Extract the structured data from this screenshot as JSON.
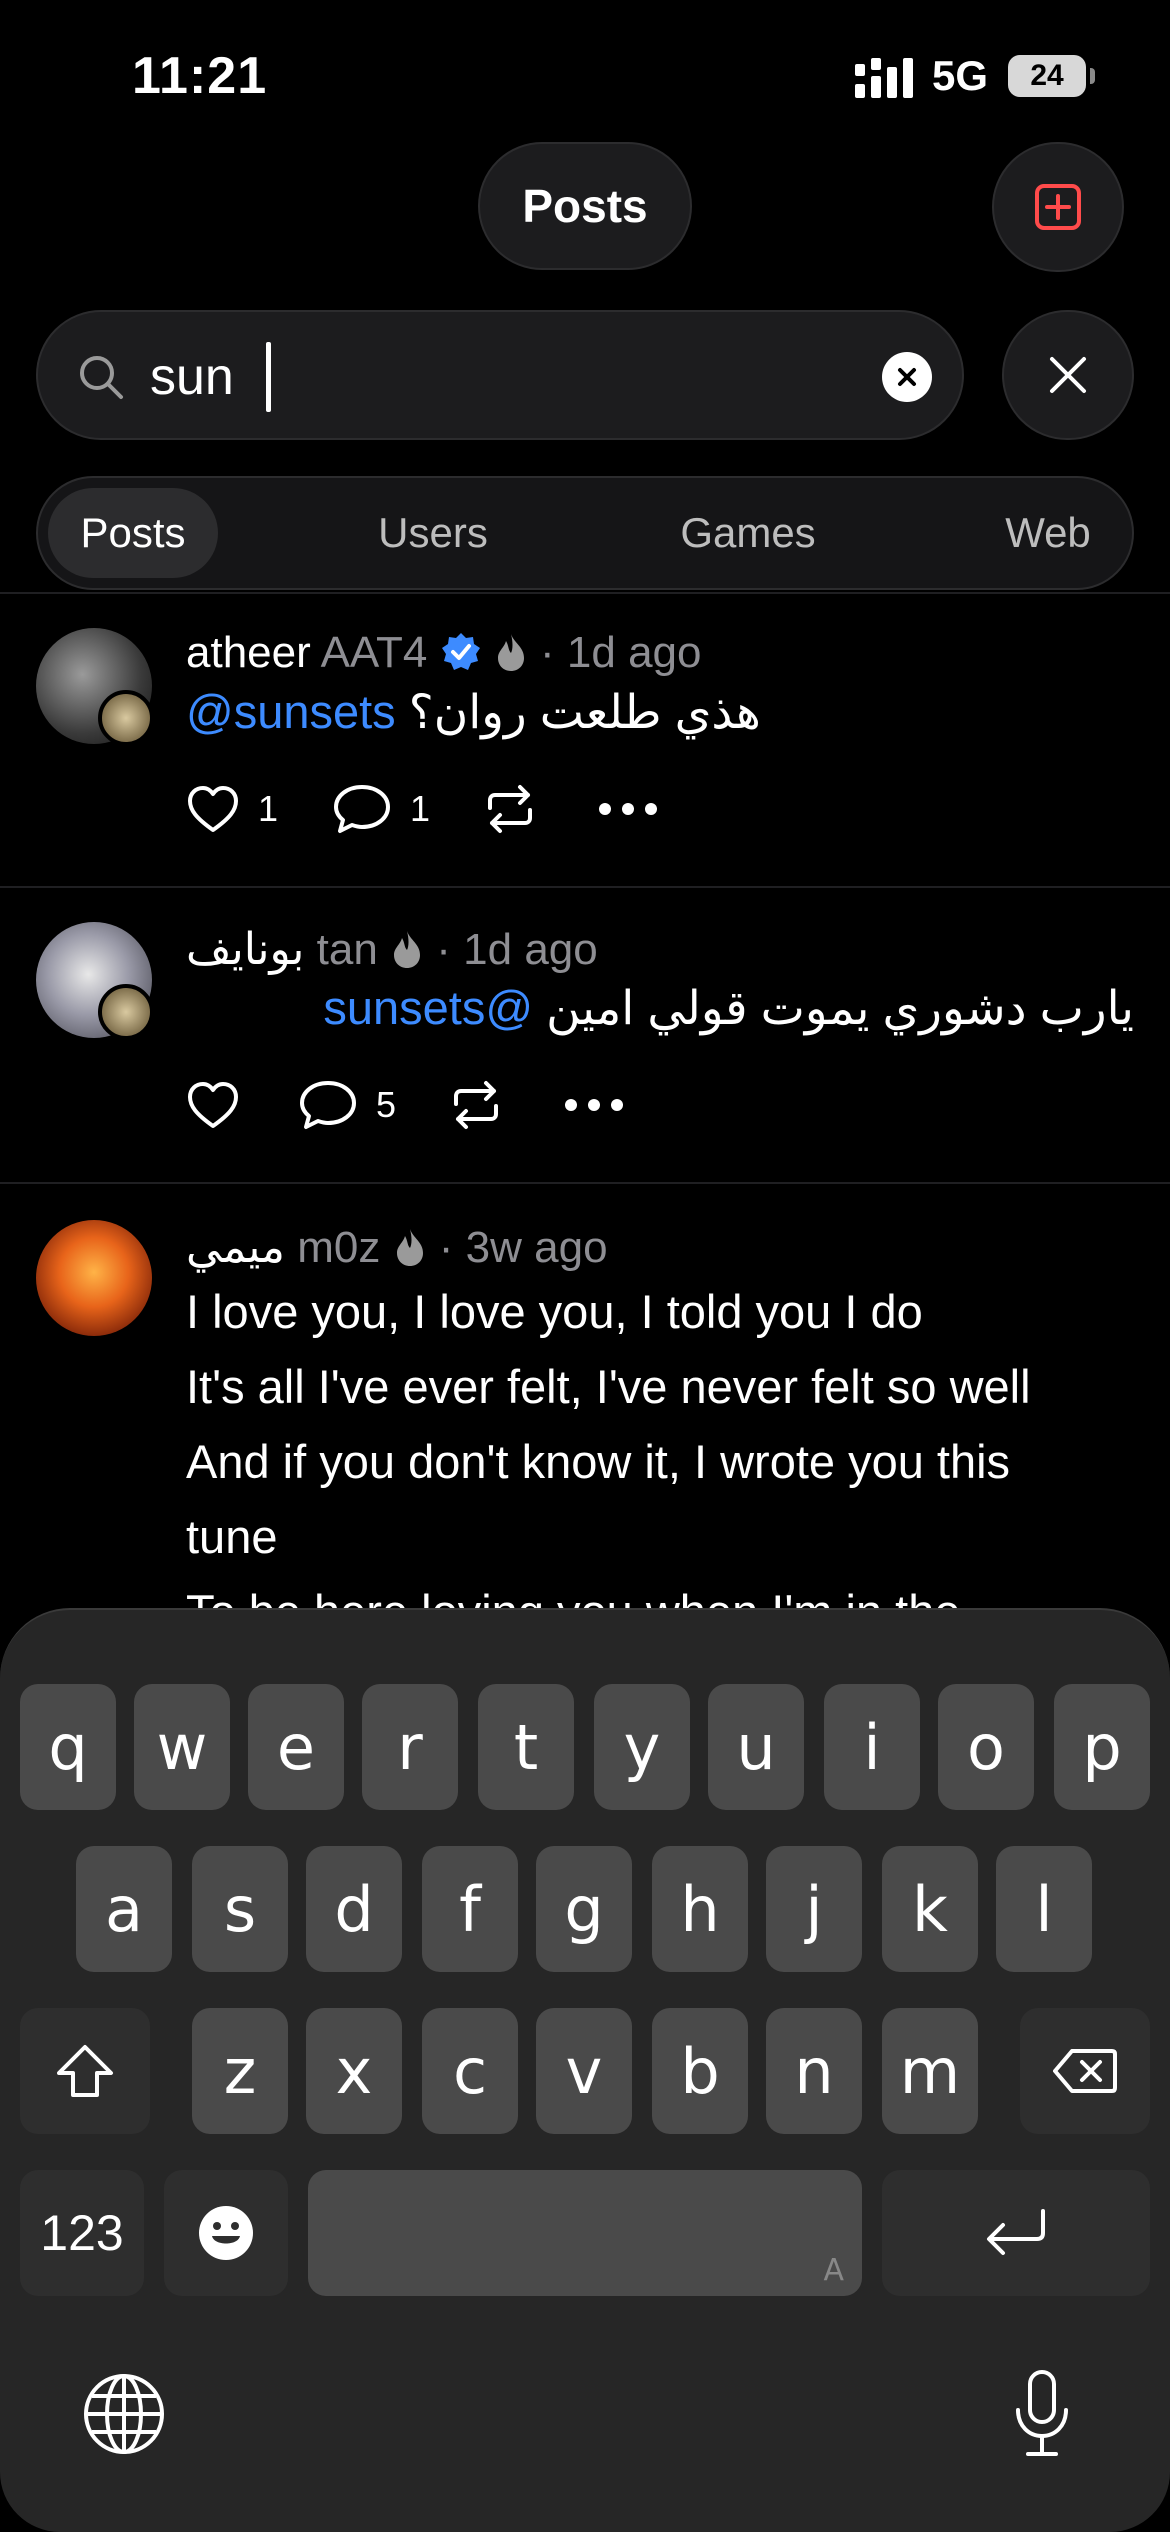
{
  "status_bar": {
    "time": "11:21",
    "network": "5G",
    "battery": "24"
  },
  "header": {
    "title": "Posts",
    "new_post_icon": "plus-square-icon"
  },
  "search": {
    "value": "sun",
    "placeholder": "Search"
  },
  "tabs": [
    {
      "label": "Posts",
      "active": true
    },
    {
      "label": "Users",
      "active": false
    },
    {
      "label": "Games",
      "active": false
    },
    {
      "label": "Web",
      "active": false
    }
  ],
  "posts": [
    {
      "name": "atheer",
      "handle": "AAT4",
      "verified": true,
      "time": "· 1d ago",
      "mention": "@sunsets",
      "text": "هذي طلعت روان؟",
      "likes": "1",
      "comments": "1"
    },
    {
      "name": "بونايف",
      "handle": "tan",
      "verified": false,
      "time": "· 1d ago",
      "mention": "sunsets@",
      "text": "يارب دشوري يموت قولي امين",
      "likes": "",
      "comments": "5"
    },
    {
      "name": "ميمي",
      "handle": "m0z",
      "verified": false,
      "time": "· 3w ago",
      "lines": [
        "I love you, I love you, I told you I do",
        "It's all I've ever felt, I've never felt so well",
        "And if you don't know it, I wrote you this",
        "tune",
        "To be here loving you when I'm in the"
      ]
    }
  ],
  "keyboard": {
    "row1": [
      "q",
      "w",
      "e",
      "r",
      "t",
      "y",
      "u",
      "i",
      "o",
      "p"
    ],
    "row2": [
      "a",
      "s",
      "d",
      "f",
      "g",
      "h",
      "j",
      "k",
      "l"
    ],
    "row3": [
      "z",
      "x",
      "c",
      "v",
      "b",
      "n",
      "m"
    ],
    "numbers_label": "123",
    "space_hint": "A"
  },
  "colors": {
    "accent": "#3d8bff",
    "new_post": "#ff4b4b",
    "background": "#000000"
  }
}
